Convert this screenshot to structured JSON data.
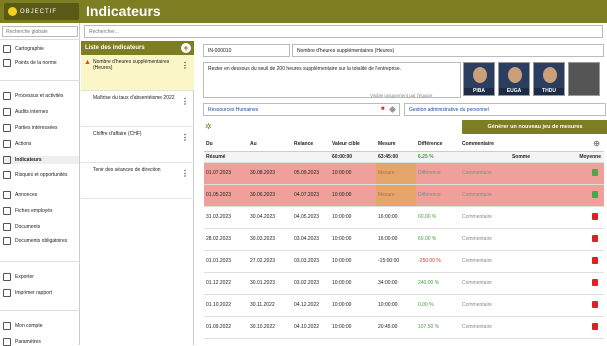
{
  "app": {
    "logo_text": "OBJECTIF",
    "page_title": "Indicateurs"
  },
  "sidebar": {
    "search_placeholder": "Recherche globale",
    "items": [
      {
        "label": "Cartographie"
      },
      {
        "label": "Points de la norme"
      },
      {
        "label": "Processus et activités"
      },
      {
        "label": "Audits internes"
      },
      {
        "label": "Parties intéressées"
      },
      {
        "label": "Actions"
      },
      {
        "label": "Indicateurs"
      },
      {
        "label": "Risques et opportunités"
      },
      {
        "label": "Annonces"
      },
      {
        "label": "Fiches employés"
      },
      {
        "label": "Documents"
      },
      {
        "label": "Documents obligatoires"
      },
      {
        "label": "Exporter"
      },
      {
        "label": "Imprimer rapport"
      },
      {
        "label": "Mon compte"
      },
      {
        "label": "Paramètres"
      }
    ]
  },
  "search": {
    "placeholder": "Rechercher..."
  },
  "list": {
    "title": "Liste des indicateurs",
    "items": [
      {
        "label": "Nombre d'heures supplémentaires (Heures)"
      },
      {
        "label": "Maîtrise du taux d'absentéisme 2022"
      },
      {
        "label": "Chiffre d'affaire (CHF)"
      },
      {
        "label": "Tenir des séances de direction"
      }
    ]
  },
  "detail": {
    "code": "IN-000010",
    "name": "Nombre d'heures supplémentaires (Heures)",
    "description": "Rester en dessous du seuil de 200 heures supplémentaire sur la totalité de l'entreprise.",
    "visible_team": "Visible uniquement par l'équipe",
    "responsible": "Ressources Humaines",
    "process": "Gestion administrative du personnel",
    "users": [
      "PIBA",
      "EUGA",
      "THDU"
    ],
    "generate_button": "Générer un nouveau jeu de mesures"
  },
  "table": {
    "headers": [
      "Du",
      "Au",
      "Relance",
      "Valeur cible",
      "Mesure",
      "Différence",
      "Commentaire",
      "Somme",
      "Moyenne"
    ],
    "summary": {
      "label": "Résumé",
      "cible": "60:00:00",
      "mesure": "63:45:00",
      "diff": "6.25 %"
    },
    "rows": [
      {
        "du": "01.07.2023",
        "au": "30.08.2023",
        "relance": "05.09.2023",
        "cible": "10:00:00",
        "mesure": "Mesure",
        "diff": "Différence",
        "comment": "Commentaire",
        "status": "red"
      },
      {
        "du": "01.05.2023",
        "au": "30.06.2023",
        "relance": "04.07.2023",
        "cible": "10:00:00",
        "mesure": "Mesure",
        "diff": "Différence",
        "comment": "Commentaire",
        "status": "red"
      },
      {
        "du": "31.03.2023",
        "au": "30.04.2023",
        "relance": "04.05.2023",
        "cible": "10:00:00",
        "mesure": "16:00:00",
        "diff": "60.00 %",
        "comment": "Commentaire",
        "status": "green"
      },
      {
        "du": "28.02.2023",
        "au": "30.03.2023",
        "relance": "03.04.2023",
        "cible": "10:00:00",
        "mesure": "16:00:00",
        "diff": "60.00 %",
        "comment": "Commentaire",
        "status": "green"
      },
      {
        "du": "01.01.2023",
        "au": "27.02.2023",
        "relance": "03.03.2023",
        "cible": "10:00:00",
        "mesure": "-15:00:00",
        "diff": "-250.00 %",
        "comment": "Commentaire",
        "status": "neg"
      },
      {
        "du": "01.12.2022",
        "au": "30.01.2023",
        "relance": "03.02.2023",
        "cible": "10:00:00",
        "mesure": "34:00:00",
        "diff": "240.00 %",
        "comment": "Commentaire",
        "status": "green"
      },
      {
        "du": "01.10.2022",
        "au": "30.11.2022",
        "relance": "04.12.2022",
        "cible": "10:00:00",
        "mesure": "10:00:00",
        "diff": "0.00 %",
        "comment": "Commentaire",
        "status": "green"
      },
      {
        "du": "01.09.2022",
        "au": "30.10.2022",
        "relance": "04.10.2022",
        "cible": "10:00:00",
        "mesure": "20:45:00",
        "diff": "107.50 %",
        "comment": "Commentaire",
        "status": "green"
      }
    ]
  }
}
